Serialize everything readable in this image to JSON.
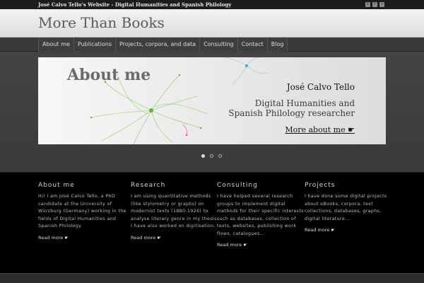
{
  "topbar": {
    "description": "José Calvo Tello's Website - Digital Humanities and Spanish Philology",
    "social_icons": [
      "twitter-icon",
      "facebook-icon",
      "rss-icon"
    ]
  },
  "header": {
    "site_title": "More Than Books"
  },
  "nav": {
    "items": [
      {
        "label": "About me"
      },
      {
        "label": "Publications"
      },
      {
        "label": "Projects, corpora, and data"
      },
      {
        "label": "Consulting"
      },
      {
        "label": "Contact"
      },
      {
        "label": "Blog"
      }
    ]
  },
  "slider": {
    "title": "About me",
    "name": "José Calvo Tello",
    "role_line1": "Digital Humanities  and",
    "role_line2": "Spanish Philology researcher",
    "more_link": "More about me ☛",
    "dots": 3,
    "active_dot": 0
  },
  "columns": [
    {
      "heading": "About me",
      "text": "Hi! I am José Calvo Tello, a PhD candidate at the University of Würzburg (Germany) working in the fields of Digital Humanities and Spanish Philology",
      "read_more": "Read more ☛"
    },
    {
      "heading": "Research",
      "text": "I am using quantitative methods (like stylometry or graphs) on modernist texts (1880-1926) to analyse literary genre in my thesis. I have also worked on digitisation.",
      "read_more": "Read more ☛"
    },
    {
      "heading": "Consulting",
      "text": "I have helped several research groups to implement digital methods for their specific interests such as databases, collection of texts, websites, publishing work flows, catalogues…",
      "read_more": "Read more ☛"
    },
    {
      "heading": "Projects",
      "text": "I have done some digital projects about eBooks, corpora, text collections, databases, graphs, digital literature…",
      "read_more": "Read more ☛"
    }
  ],
  "colors": {
    "background": "#2b2b2b",
    "header_bg": "#ececec",
    "content_bg": "#000000",
    "accent_green": "#7ac943"
  }
}
